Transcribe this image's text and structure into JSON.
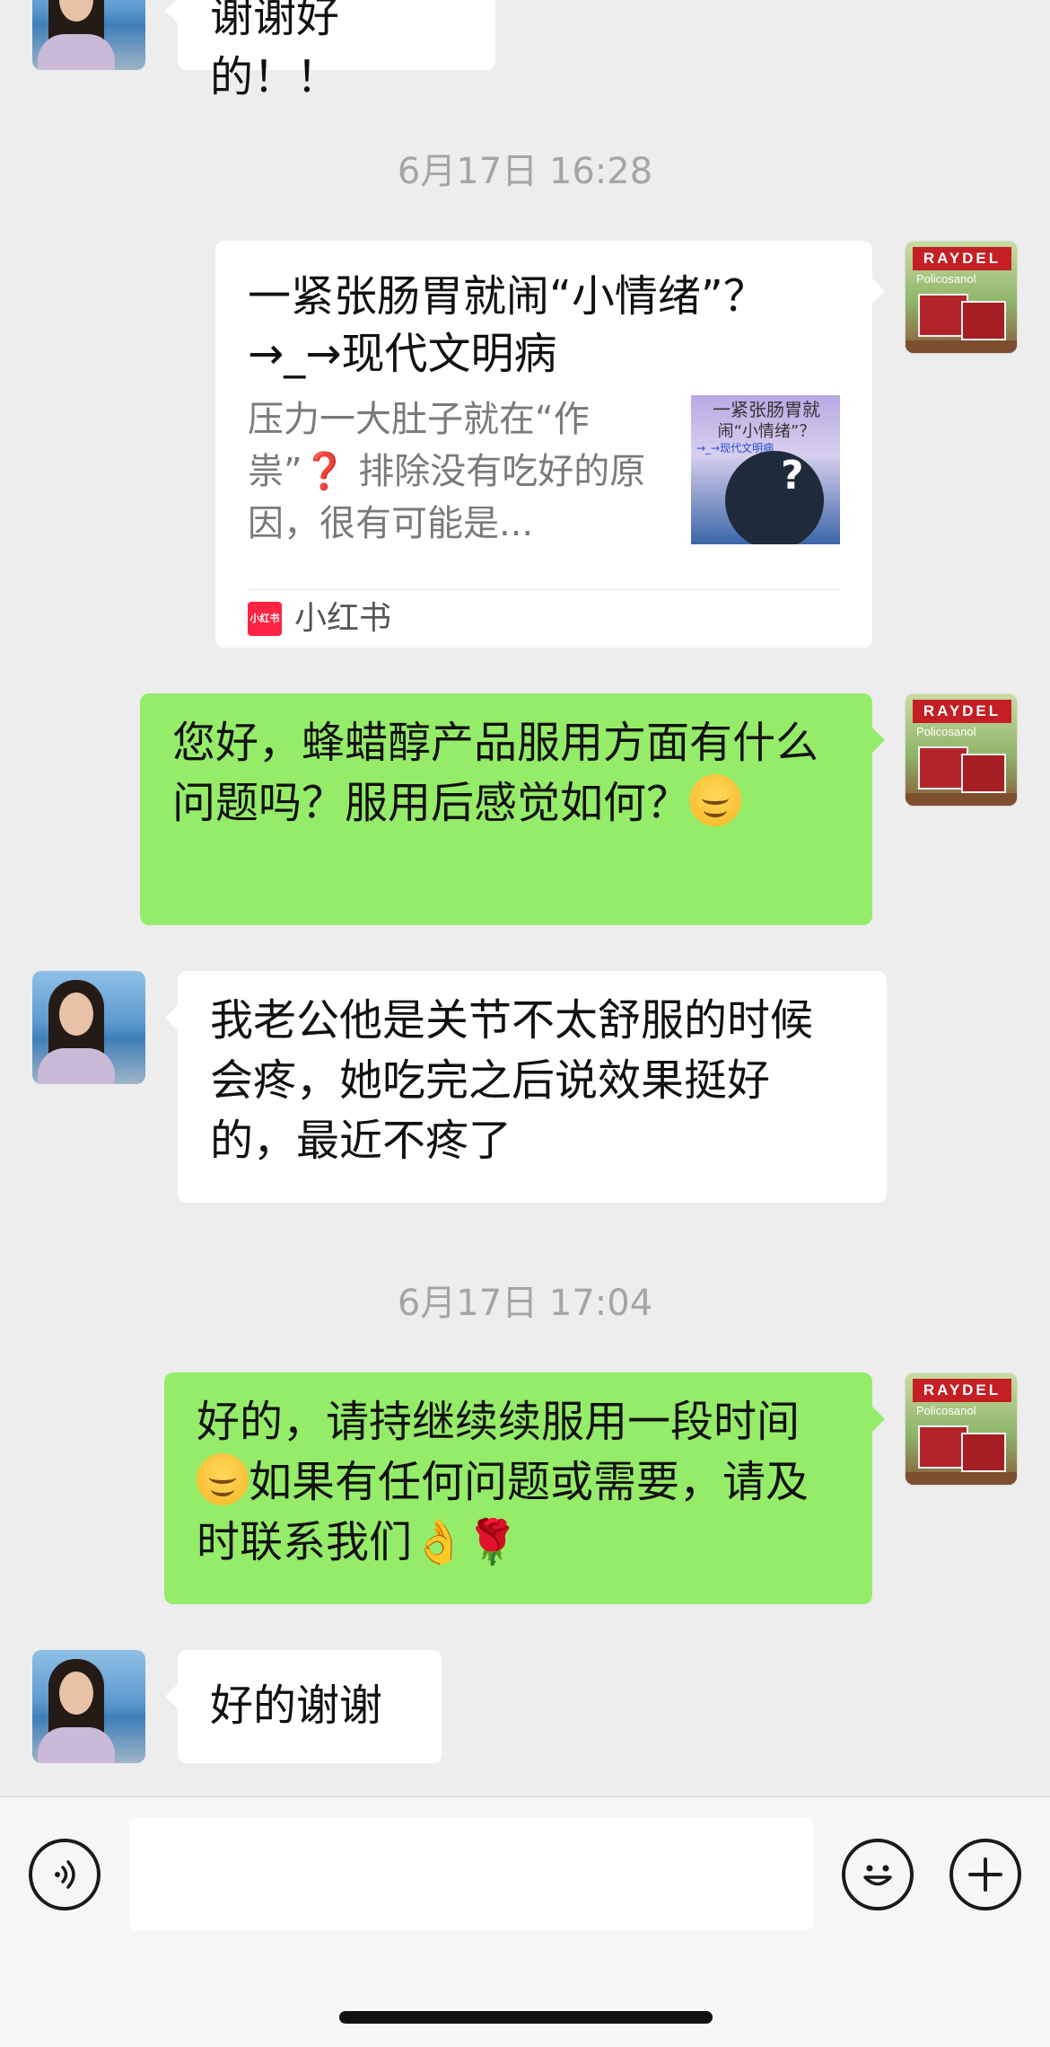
{
  "messages": {
    "m0_text": "谢谢好的！！",
    "ts1": "6月17日 16:28",
    "card": {
      "title": "一紧张肠胃就闹“小情绪”？→_→现代文明病",
      "desc": "压力一大肚子就在“作祟”❓ 排除没有吃好的原因，很有可能是...",
      "source": "小红书",
      "source_icon_text": "小红书",
      "thumb_line1": "一紧张肠胃就",
      "thumb_line2": "闹“小情绪”？",
      "thumb_line3": "→_→现代文明病"
    },
    "m2_text": "您好，蜂蜡醇产品服用方面有什么问题吗？服用后感觉如何？",
    "m3_text": "我老公他是关节不太舒服的时候会疼，她吃完之后说效果挺好的，最近不疼了",
    "ts2": "6月17日 17:04",
    "m4_part1": "好的，请持继续续服用一段时间",
    "m4_part2": "如果有任何问题或需要，请及时联系我们",
    "m4_emoji_tail": "👌🌹",
    "m5_text": "好的谢谢"
  },
  "brand_avatar": {
    "logo_text": "RAYDEL",
    "sub_text": "Policosanol"
  },
  "input_bar": {
    "voice_icon": "voice-icon",
    "emoji_icon": "emoji-icon",
    "plus_icon": "plus-icon",
    "placeholder": ""
  }
}
